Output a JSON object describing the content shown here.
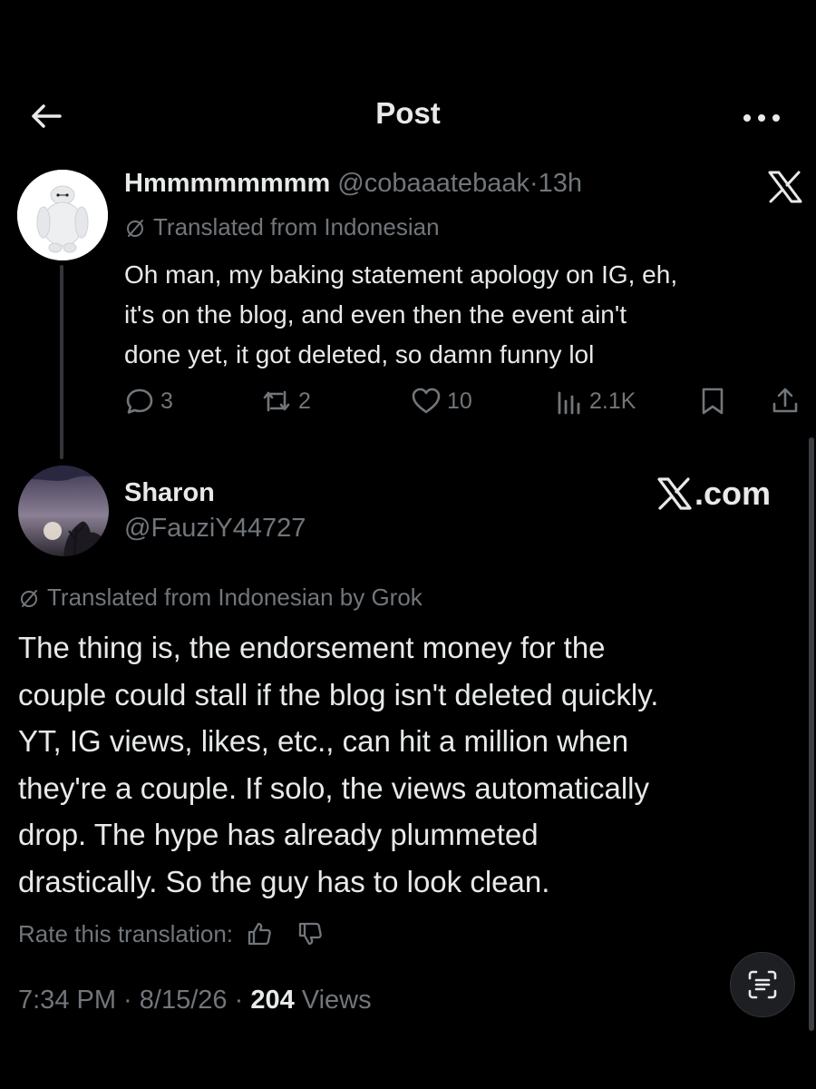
{
  "header": {
    "title": "Post"
  },
  "post1": {
    "display_name": "Hmmmmmmmm",
    "handle": "@cobaaatebaak",
    "separator": "·",
    "time": "13h",
    "translated_label": "Translated from Indonesian",
    "body_lines": [
      "Oh man, my baking statement apology on IG, eh,",
      "it's on the blog, and even then the event ain't",
      "done yet, it got deleted, so damn funny lol"
    ],
    "actions": {
      "replies": "3",
      "reposts": "2",
      "likes": "10",
      "views": "2.1K"
    }
  },
  "post2": {
    "display_name": "Sharon",
    "handle": "@FauziY44727",
    "watermark": ".com",
    "translated_label": "Translated from Indonesian by Grok",
    "body_lines": [
      "The thing is, the endorsement money for the",
      "couple could stall if the blog isn't deleted quickly.",
      "YT, IG views, likes, etc., can hit a million when",
      "they're a couple. If solo, the views automatically",
      "drop. The hype has already plummeted",
      "drastically. So the guy has to look clean."
    ],
    "rate_label": "Rate this translation:",
    "timestamp": "7:34 PM · 8/15/26 · ",
    "views_count": "204",
    "views_label": " Views"
  },
  "colors": {
    "background": "#000000",
    "primary_text": "#e7e9ea",
    "secondary_text": "#71767b"
  },
  "icons": {
    "back": "arrow-left-icon",
    "more": "more-dots-icon",
    "x_logo": "x-logo-icon",
    "translate": "globe-slash-icon",
    "reply": "reply-bubble-icon",
    "repost": "repost-icon",
    "like": "heart-icon",
    "views": "views-bars-icon",
    "bookmark": "bookmark-icon",
    "share": "share-icon",
    "thumbs_up": "thumbs-up-icon",
    "thumbs_down": "thumbs-down-icon",
    "scan": "text-scan-icon"
  }
}
